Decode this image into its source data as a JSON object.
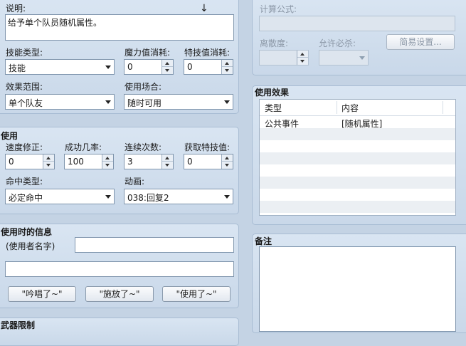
{
  "left": {
    "description_label": "说明:",
    "description_value": "给予单个队员随机属性。",
    "skill_type_label": "技能类型:",
    "skill_type_value": "技能",
    "mp_cost_label": "魔力值消耗:",
    "mp_cost_value": "0",
    "tp_cost_label": "特技值消耗:",
    "tp_cost_value": "0",
    "scope_label": "效果范围:",
    "scope_value": "单个队友",
    "occasion_label": "使用场合:",
    "occasion_value": "随时可用"
  },
  "invocation": {
    "title": "使用",
    "speed_label": "速度修正:",
    "speed_value": "0",
    "success_label": "成功几率:",
    "success_value": "100",
    "repeats_label": "连续次数:",
    "repeats_value": "3",
    "tp_gain_label": "获取特技值:",
    "tp_gain_value": "0",
    "hit_type_label": "命中类型:",
    "hit_type_value": "必定命中",
    "animation_label": "动画:",
    "animation_value": "038:回复2"
  },
  "message": {
    "title": "使用时的信息",
    "user_name_label": "(使用者名字)",
    "line1_value": "",
    "line2_value": "",
    "btn_chant": "\"吟唱了~\"",
    "btn_cast": "\"施放了~\"",
    "btn_use": "\"使用了~\""
  },
  "bottom_left_title": "武器限制",
  "damage": {
    "formula_label": "计算公式:",
    "formula_value": "",
    "variance_label": "离散度:",
    "variance_value": "",
    "critical_label": "允许必杀:",
    "critical_value": "",
    "simple_setup_button": "简易设置..."
  },
  "effects": {
    "title": "使用效果",
    "columns": [
      "类型",
      "内容"
    ],
    "rows": [
      {
        "type": "公共事件",
        "content": "[随机属性]"
      }
    ]
  },
  "note": {
    "title": "备注",
    "value": ""
  },
  "cursor_glyph": "↓"
}
